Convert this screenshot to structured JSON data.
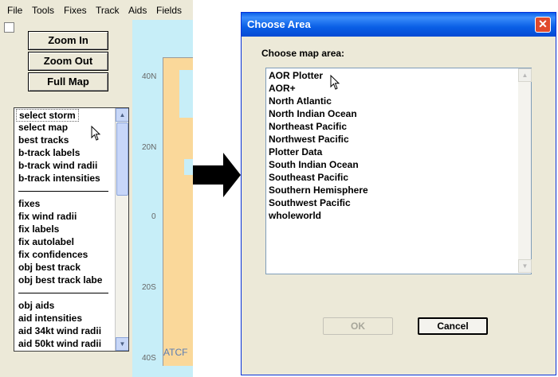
{
  "menubar": {
    "items": [
      "File",
      "Tools",
      "Fixes",
      "Track",
      "Aids",
      "Fields"
    ]
  },
  "buttons": {
    "zoom_in": "Zoom In",
    "zoom_out": "Zoom Out",
    "full_map": "Full Map"
  },
  "layers": {
    "group1": [
      "select storm",
      "select map",
      "best tracks",
      "b-track labels",
      "b-track wind radii",
      "b-track intensities"
    ],
    "group2": [
      "fixes",
      "fix wind radii",
      "fix labels",
      "fix autolabel",
      "fix confidences",
      "obj best track",
      "obj best track labe"
    ],
    "group3": [
      "obj aids",
      "aid intensities",
      "aid 34kt wind radii",
      "aid 50kt wind radii"
    ]
  },
  "map": {
    "lat_labels": [
      "40N",
      "20N",
      "0",
      "20S",
      "40S"
    ],
    "footer": "ATCF"
  },
  "dialog": {
    "title": "Choose Area",
    "close_glyph": "✕",
    "prompt": "Choose map area:",
    "areas": [
      "AOR Plotter",
      "AOR+",
      "North Atlantic",
      "North Indian Ocean",
      "Northeast Pacific",
      "Northwest Pacific",
      "Plotter Data",
      "South Indian Ocean",
      "Southeast Pacific",
      "Southern Hemisphere",
      "Southwest Pacific",
      "wholeworld"
    ],
    "ok_label": "OK",
    "cancel_label": "Cancel"
  },
  "icons": {
    "scroll_up": "▲",
    "scroll_down": "▼",
    "arrow": "arrow-right-icon",
    "cursor": "mouse-pointer-icon"
  },
  "colors": {
    "titlebar": "#0a5fe6",
    "map_water": "#c7eef8",
    "map_land": "#fad89a",
    "window_bg": "#ece9d8"
  }
}
